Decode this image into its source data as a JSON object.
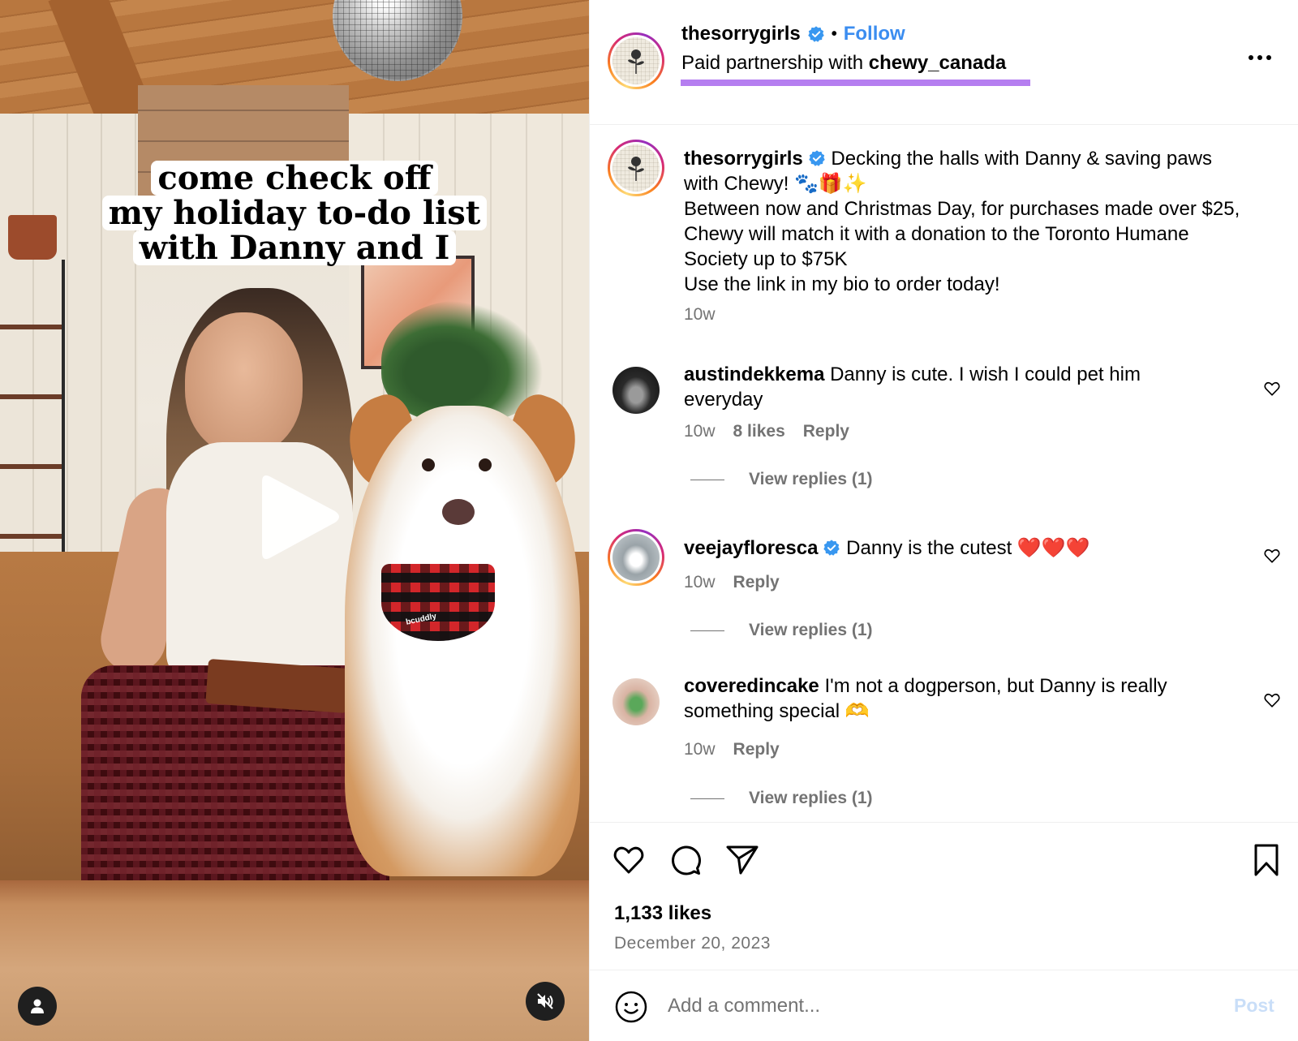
{
  "media": {
    "overlay_caption_lines": [
      "come check off",
      "my holiday to-do list",
      "with Danny and I"
    ],
    "bandana_text": "bcuddly",
    "icons": {
      "play": "play-icon",
      "user_tags": "user-icon",
      "mute": "speaker-muted-icon"
    }
  },
  "header": {
    "username": "thesorrygirls",
    "verified": true,
    "separator": "•",
    "follow_label": "Follow",
    "partnership_prefix": "Paid partnership with ",
    "partner": "chewy_canada",
    "highlight_color": "#b57ef0",
    "more_icon": "more-options-icon"
  },
  "caption": {
    "username": "thesorrygirls",
    "text_line1": " Decking the halls with Danny & saving paws with Chewy! 🐾🎁✨",
    "text_line2": "Between now and Christmas Day, for purchases made over $25, Chewy will match it with a donation to the Toronto Humane Society up to $75K",
    "text_line3": "Use the link in my bio to order today!",
    "time": "10w"
  },
  "comments": [
    {
      "username": "austindekkema",
      "verified": false,
      "text": " Danny is cute. I wish I could pet him everyday",
      "time": "10w",
      "likes": "8 likes",
      "reply_label": "Reply",
      "view_replies": "View replies (1)"
    },
    {
      "username": "veejayfloresca",
      "verified": true,
      "text": " Danny is the cutest ❤️❤️❤️",
      "time": "10w",
      "likes": null,
      "reply_label": "Reply",
      "view_replies": "View replies (1)"
    },
    {
      "username": "coveredincake",
      "verified": false,
      "text": " I'm not a dogperson, but Danny is really something special 🫶",
      "time": "10w",
      "likes": null,
      "reply_label": "Reply",
      "view_replies": "View replies (1)"
    }
  ],
  "actions": {
    "icons": [
      "heart-icon",
      "comment-icon",
      "share-icon",
      "bookmark-icon"
    ],
    "likes": "1,133 likes",
    "date": "December 20, 2023"
  },
  "comment_box": {
    "placeholder": "Add a comment...",
    "value": "",
    "post_label": "Post",
    "emoji_icon": "emoji-icon"
  },
  "colors": {
    "follow_blue": "#3b8df0",
    "muted_text": "#737373",
    "post_disabled": "#c9def8",
    "verified_blue": "#3897f0"
  }
}
